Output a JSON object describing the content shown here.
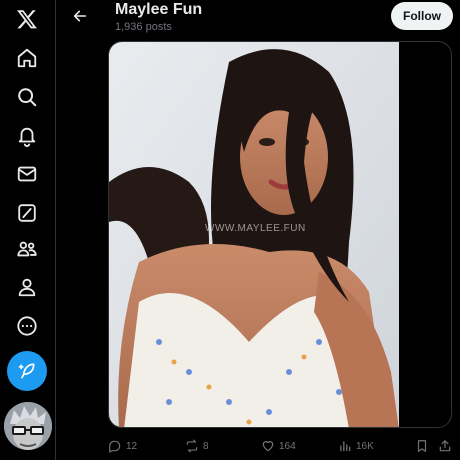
{
  "header": {
    "title": "Maylee Fun",
    "subtitle": "1,936 posts",
    "follow_label": "Follow"
  },
  "nav": {
    "items": [
      {
        "icon": "x-logo-icon"
      },
      {
        "icon": "home-icon"
      },
      {
        "icon": "search-icon"
      },
      {
        "icon": "bell-icon"
      },
      {
        "icon": "mail-icon"
      },
      {
        "icon": "grok-icon"
      },
      {
        "icon": "communities-icon"
      },
      {
        "icon": "profile-icon"
      },
      {
        "icon": "more-icon"
      }
    ],
    "compose_icon": "feather-icon",
    "accent": "#1d9bf0"
  },
  "media": {
    "watermark": "WWW.MAYLEE.FUN"
  },
  "actions": {
    "replies": "12",
    "reposts": "8",
    "likes": "164",
    "views": "16K"
  },
  "colors": {
    "background": "#000000",
    "text": "#e7e9ea",
    "muted": "#71767b",
    "border": "#2f3336",
    "follow_bg": "#eff3f4"
  }
}
